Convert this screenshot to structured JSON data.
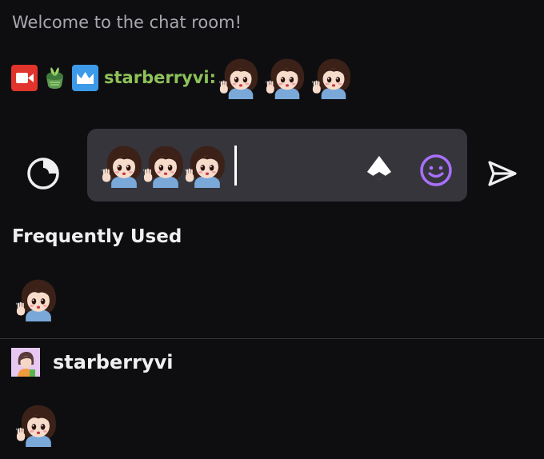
{
  "chat": {
    "welcome_message": "Welcome to the chat room!",
    "message": {
      "badges": [
        "camera-badge-icon",
        "plant-badge-icon",
        "crown-badge-icon"
      ],
      "username": "starberryvi:",
      "username_color": "#8ec25a",
      "emote_count": 3
    }
  },
  "composer": {
    "input_emote_count": 3,
    "icons": {
      "left": "spinner-icon",
      "bits": "bits-icon",
      "emote_picker": "smiley-icon",
      "send": "send-icon"
    },
    "emote_picker_color": "#a970ff"
  },
  "picker": {
    "frequently_used_title": "Frequently Used",
    "channel_name": "starberryvi"
  },
  "colors": {
    "background": "#0e0e10",
    "input_background": "#35353b",
    "accent": "#a970ff"
  }
}
